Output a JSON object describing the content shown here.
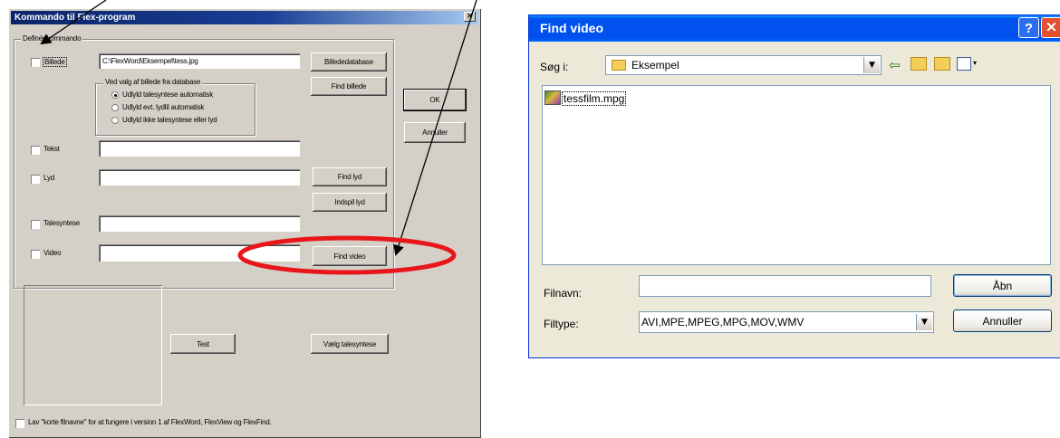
{
  "left_dialog": {
    "title": "Kommando til Flex-program",
    "close_glyph": "×",
    "group_label": "Definér kommando",
    "rows": {
      "billede": {
        "label": "Billede",
        "value": "C:\\FlexWord\\Eksempel\\tess.jpg"
      },
      "tekst": {
        "label": "Tekst",
        "value": ""
      },
      "lyd": {
        "label": "Lyd",
        "value": ""
      },
      "talesyntese": {
        "label": "Talesyntese",
        "value": ""
      },
      "video": {
        "label": "Video",
        "value": ""
      }
    },
    "subgroup_label": "Ved valg af billede fra database",
    "radios": [
      "Udlyld talesyntese automatisk",
      "Udlyld evt. lydlil automatisk",
      "Udlyld ikke talesyntese eller lyd"
    ],
    "buttons": {
      "billededatabase": "Billededatabase",
      "find_billede": "Find billede",
      "ok": "OK",
      "annuller": "Annuller",
      "find_lyd": "Find lyd",
      "indspil_lyd": "Indspil lyd",
      "find_video": "Find video",
      "test": "Test",
      "vaelg_talesyntese": "Vælg talesyntese"
    },
    "footer_checkbox": "Lav \"korte filnavne\" for at fungere i version 1 af FlexWord, FlexView og FlexFind."
  },
  "right_dialog": {
    "title": "Find video",
    "help_glyph": "?",
    "close_glyph": "×",
    "look_in_label": "Søg i:",
    "look_in_value": "Eksempel",
    "files": [
      "tessfilm.mpg"
    ],
    "filename_label": "Filnavn:",
    "filename_value": "",
    "filetype_label": "Filtype:",
    "filetype_value": "AVI,MPE,MPEG,MPG,MOV,WMV",
    "open_button": "Åbn",
    "cancel_button": "Annuller"
  },
  "colors": {
    "annotation_red": "#e8161b",
    "xp_title": "#0053ee",
    "classic_title": "#0a246a"
  }
}
